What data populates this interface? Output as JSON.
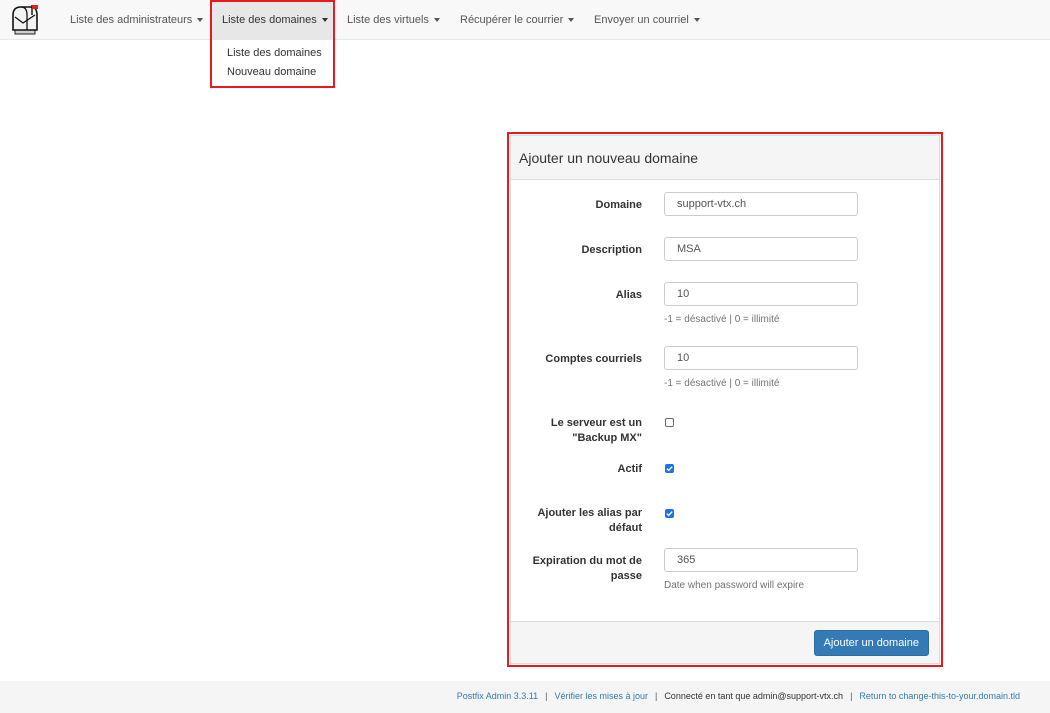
{
  "navbar": {
    "items": [
      {
        "label": "Liste des administrateurs"
      },
      {
        "label": "Liste des domaines"
      },
      {
        "label": "Liste des virtuels"
      },
      {
        "label": "Récupérer le courrier"
      },
      {
        "label": "Envoyer un courriel"
      }
    ],
    "active_index": 1
  },
  "dropdown": {
    "items": [
      {
        "label": "Liste des domaines"
      },
      {
        "label": "Nouveau domaine"
      }
    ]
  },
  "form": {
    "title": "Ajouter un nouveau domaine",
    "fields": {
      "domain": {
        "label": "Domaine",
        "value": "support-vtx.ch"
      },
      "description": {
        "label": "Description",
        "value": "MSA"
      },
      "aliases": {
        "label": "Alias",
        "value": "10",
        "help": "-1 = désactivé | 0 = illimité"
      },
      "mailboxes": {
        "label": "Comptes courriels",
        "value": "10",
        "help": "-1 = désactivé | 0 = illimité"
      },
      "backup_mx": {
        "label": "Le serveur est un \"Backup MX\"",
        "checked": false
      },
      "active": {
        "label": "Actif",
        "checked": true
      },
      "default_aliases": {
        "label": "Ajouter les alias par défaut",
        "checked": true
      },
      "password_expiry": {
        "label": "Expiration du mot de passe",
        "value": "365",
        "help": "Date when password will expire"
      }
    },
    "submit_label": "Ajouter un domaine"
  },
  "footer": {
    "version": "Postfix Admin 3.3.11",
    "check_updates": "Vérifier les mises à jour",
    "logged_in": "Connecté en tant que admin@support-vtx.ch",
    "return_link": "Return to change-this-to-your.domain.tld",
    "separator": "|"
  },
  "colors": {
    "accent": "#337ab7",
    "highlight": "#e8191f",
    "checkbox_checked": "#1a73e8"
  }
}
